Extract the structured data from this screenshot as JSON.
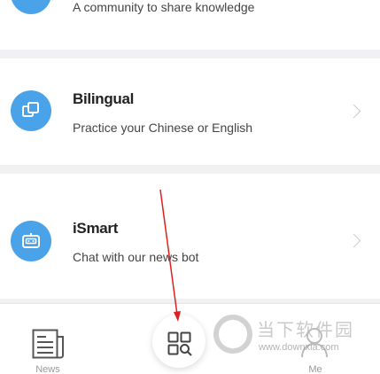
{
  "items": [
    {
      "desc": "A community to share knowledge",
      "icon": "community-icon"
    },
    {
      "title": "Bilingual",
      "desc": "Practice your Chinese or English",
      "icon": "bilingual-icon"
    },
    {
      "title": "iSmart",
      "desc": "Chat with our news bot",
      "icon": "robot-icon"
    }
  ],
  "tabbar": {
    "news_label": "News",
    "me_label": "Me"
  },
  "watermark": {
    "chinese": "当下软件园",
    "url": "www.downxia.com"
  },
  "colors": {
    "accent": "#4aa3e8",
    "annotation": "#e02020"
  }
}
